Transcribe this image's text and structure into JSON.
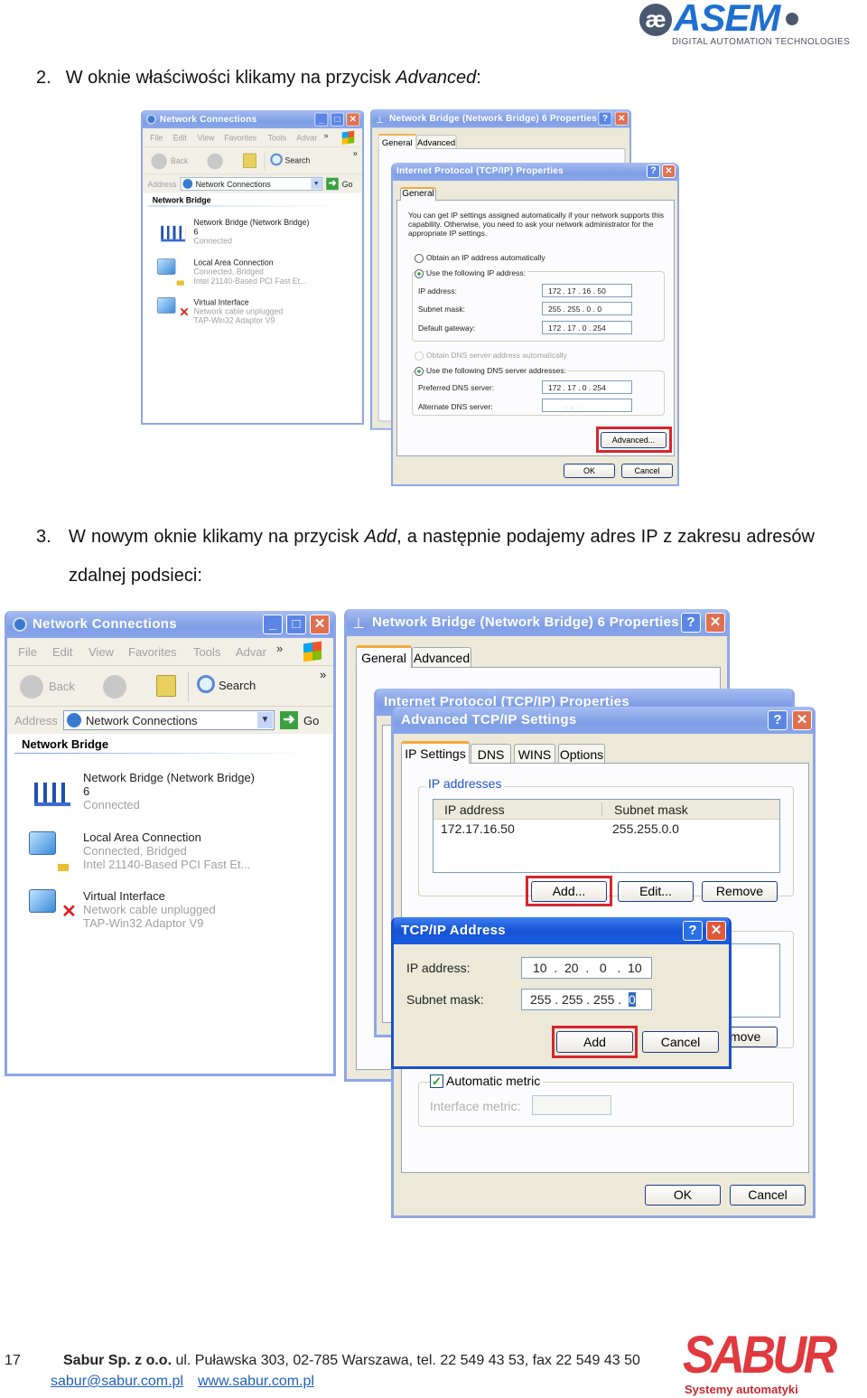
{
  "header": {
    "logo_prefix": "æ",
    "logo_text": "ASEM",
    "logo_tagline": "DIGITAL AUTOMATION TECHNOLOGIES",
    "brand_color": "#1e4f9c"
  },
  "steps": [
    {
      "number": "2.",
      "text_before": "W oknie właściwości klikamy na przycisk ",
      "emphasis": "Advanced",
      "text_after": ":"
    },
    {
      "number": "3.",
      "text_before": "W nowym oknie klikamy na przycisk ",
      "emphasis": "Add",
      "text_after": ", a następnie podajemy adres IP z zakresu adresów zdalnej podsieci:"
    }
  ],
  "network_connections": {
    "title": "Network Connections",
    "menu": [
      "File",
      "Edit",
      "View",
      "Favorites",
      "Tools",
      "Advar",
      "»"
    ],
    "toolbar": {
      "back": "Back",
      "search": "Search",
      "more": "»"
    },
    "address_label": "Address",
    "address_value": "Network Connections",
    "go": "Go",
    "section": "Network Bridge",
    "items": [
      {
        "name": "Network Bridge (Network Bridge)",
        "line2": "6",
        "line3": "Connected"
      },
      {
        "name": "Local Area Connection",
        "line2": "Connected, Bridged",
        "line3": "Intel 21140-Based PCI Fast Et..."
      },
      {
        "name": "Virtual Interface",
        "line2": "Network cable unplugged",
        "line3": "TAP-Win32 Adaptor V9"
      }
    ]
  },
  "bridge_properties": {
    "title": "Network Bridge (Network Bridge) 6 Properties",
    "tabs": [
      "General",
      "Advanced"
    ],
    "help": "?",
    "close": "✕"
  },
  "tcpip_properties": {
    "title": "Internet Protocol (TCP/IP) Properties",
    "tab": "General",
    "description": "You can get IP settings assigned automatically if your network supports this capability. Otherwise, you need to ask your network administrator for the appropriate IP settings.",
    "radio_auto_ip": "Obtain an IP address automatically",
    "radio_manual_ip": "Use the following IP address:",
    "ip_label": "IP address:",
    "ip_value": "172 . 17 . 16 . 50",
    "mask_label": "Subnet mask:",
    "mask_value": "255 . 255 . 0 . 0",
    "gateway_label": "Default gateway:",
    "gateway_value": "172 . 17 . 0 . 254",
    "radio_auto_dns": "Obtain DNS server address automatically",
    "radio_manual_dns": "Use the following DNS server addresses:",
    "pref_dns_label": "Preferred DNS server:",
    "pref_dns_value": "172 . 17 . 0 . 254",
    "alt_dns_label": "Alternate DNS server:",
    "alt_dns_value": " .  .  . ",
    "advanced": "Advanced...",
    "ok": "OK",
    "cancel": "Cancel"
  },
  "advanced_tcpip": {
    "title": "Advanced TCP/IP Settings",
    "tabs": [
      "IP Settings",
      "DNS",
      "WINS",
      "Options"
    ],
    "group": "IP addresses",
    "columns": [
      "IP address",
      "Subnet mask"
    ],
    "rows": [
      [
        "172.17.16.50",
        "255.255.0.0"
      ]
    ],
    "add": "Add...",
    "edit": "Edit...",
    "remove": "Remove",
    "remove_partial": "move",
    "auto_metric": "Automatic metric",
    "auto_metric_checked": true,
    "interface_metric": "Interface metric:",
    "ok": "OK",
    "cancel": "Cancel"
  },
  "tcpip_address": {
    "title": "TCP/IP Address",
    "ip_label": "IP address:",
    "ip_value": "10  .  20  .   0   .  10",
    "mask_label": "Subnet mask:",
    "mask_value": "255 . 255 . 255 .  ",
    "mask_selected": "0",
    "add": "Add",
    "cancel": "Cancel"
  },
  "highlight_color": "#d7262c",
  "footer": {
    "page": "17",
    "company": "Sabur Sp. z o.o.",
    "address": " ul. Puławska 303, 02-785 Warszawa, tel. 22 549 43 53, fax 22 549 43 50",
    "email": "sabur@sabur.com.pl",
    "website": "www.sabur.com.pl",
    "logo_text": "SABUR",
    "logo_tagline": "Systemy automatyki",
    "logo_color": "#e0393e"
  }
}
